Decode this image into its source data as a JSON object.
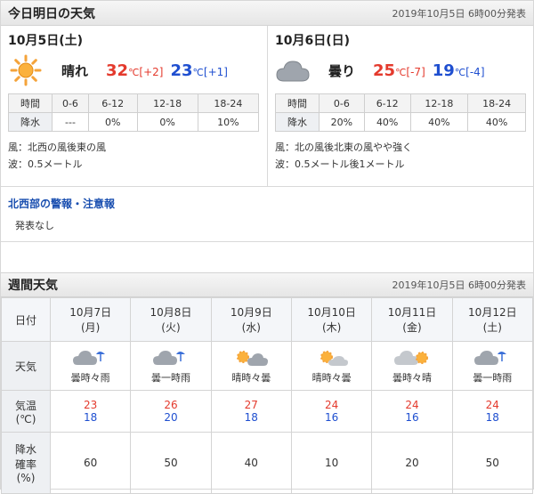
{
  "today_header": {
    "title": "今日明日の天気",
    "issued": "2019年10月5日 6時00分発表"
  },
  "days": [
    {
      "date": "10月5日(土)",
      "weather": "晴れ",
      "icon": "sun-icon",
      "high": "32",
      "high_diff": "[+2]",
      "low": "23",
      "low_diff": "[+1]",
      "unit": "℃",
      "rain_label": "時間",
      "rain_row_label": "降水",
      "periods": [
        "0-6",
        "6-12",
        "12-18",
        "18-24"
      ],
      "rain": [
        "---",
        "0%",
        "0%",
        "10%"
      ],
      "wind": "風：北西の風後東の風",
      "wave": "波：0.5メートル"
    },
    {
      "date": "10月6日(日)",
      "weather": "曇り",
      "icon": "cloud-icon",
      "high": "25",
      "high_diff": "[-7]",
      "low": "19",
      "low_diff": "[-4]",
      "unit": "℃",
      "rain_label": "時間",
      "rain_row_label": "降水",
      "periods": [
        "0-6",
        "6-12",
        "12-18",
        "18-24"
      ],
      "rain": [
        "20%",
        "40%",
        "40%",
        "40%"
      ],
      "wind": "風：北の風後北東の風やや強く",
      "wave": "波：0.5メートル後1メートル"
    }
  ],
  "warning": {
    "title": "北西部の警報・注意報",
    "text": "発表なし"
  },
  "weekly_header": {
    "title": "週間天気",
    "issued": "2019年10月5日 6時00分発表"
  },
  "weekly": {
    "labels": {
      "date": "日付",
      "weather": "天気",
      "temp": "気温\n(℃)",
      "precip": "降水\n確率\n(%)"
    },
    "days": [
      {
        "date": "10月7日\n(月)",
        "icon": "cloud-rain-icon",
        "weather": "曇時々雨",
        "high": "23",
        "low": "18",
        "precip": "60"
      },
      {
        "date": "10月8日\n(火)",
        "icon": "cloud-rain-icon",
        "weather": "曇一時雨",
        "high": "26",
        "low": "20",
        "precip": "50"
      },
      {
        "date": "10月9日\n(水)",
        "icon": "sun-cloud-icon",
        "weather": "晴時々曇",
        "high": "27",
        "low": "18",
        "precip": "40"
      },
      {
        "date": "10月10日\n(木)",
        "icon": "sun-cloud-icon",
        "weather": "晴時々曇",
        "high": "24",
        "low": "16",
        "precip": "10"
      },
      {
        "date": "10月11日\n(金)",
        "icon": "cloud-sun-icon",
        "weather": "曇時々晴",
        "high": "24",
        "low": "16",
        "precip": "20"
      },
      {
        "date": "10月12日\n(土)",
        "icon": "cloud-rain-icon",
        "weather": "曇一時雨",
        "high": "24",
        "low": "18",
        "precip": "50"
      }
    ]
  }
}
